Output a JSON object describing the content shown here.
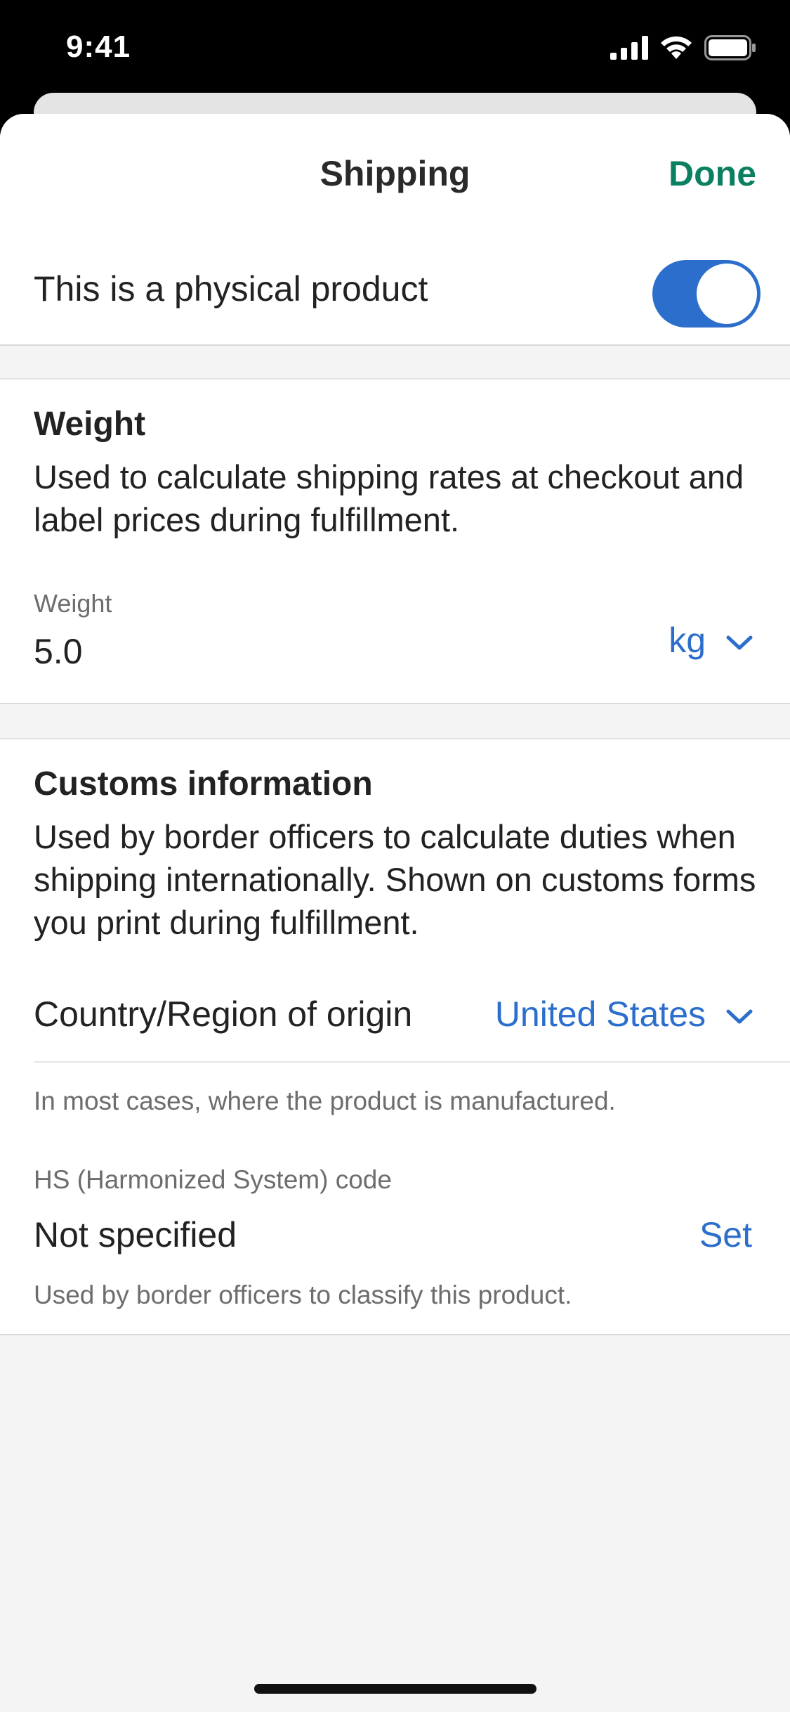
{
  "status_bar": {
    "time": "9:41"
  },
  "nav": {
    "title": "Shipping",
    "done_label": "Done"
  },
  "physical_product": {
    "label": "This is a physical product",
    "enabled": true
  },
  "weight_section": {
    "title": "Weight",
    "description": "Used to calculate shipping rates at checkout and label prices during fulfillment.",
    "field_label": "Weight",
    "value": "5.0",
    "unit": "kg"
  },
  "customs_section": {
    "title": "Customs information",
    "description": "Used by border officers to calculate duties when shipping internationally. Shown on customs forms you print during fulfillment.",
    "country_label": "Country/Region of origin",
    "country_value": "United States",
    "country_help": "In most cases, where the product is manufactured.",
    "hs_label": "HS (Harmonized System) code",
    "hs_value": "Not specified",
    "hs_action": "Set",
    "hs_help": "Used by border officers to classify this product."
  },
  "colors": {
    "accent_blue": "#2c6ecb",
    "done_green": "#0b8060",
    "background": "#f4f4f4"
  },
  "icons": [
    "cellular-signal-icon",
    "wifi-icon",
    "battery-icon",
    "chevron-down-icon"
  ]
}
